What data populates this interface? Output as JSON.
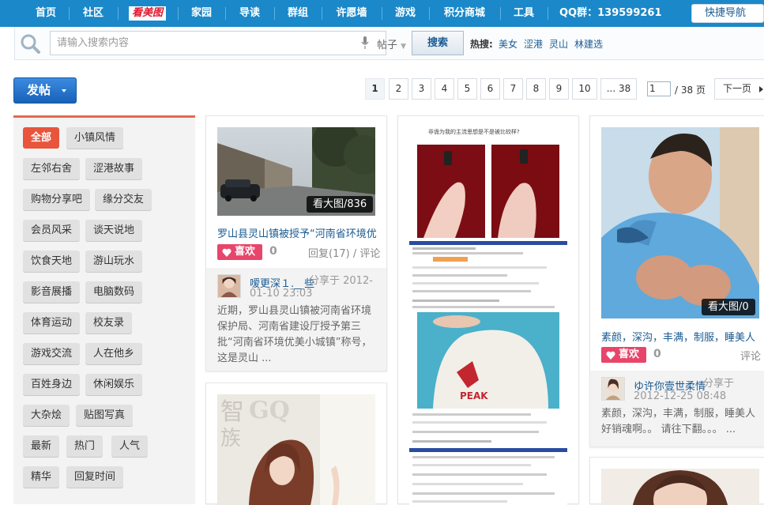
{
  "nav": {
    "items": [
      "首页",
      "社区",
      "看美图",
      "家园",
      "导读",
      "群组",
      "许愿墙",
      "游戏",
      "积分商城",
      "工具"
    ],
    "qq": "QQ群：139599261",
    "quick_nav": "快捷导航"
  },
  "search": {
    "placeholder": "请输入搜索内容",
    "type": "帖子",
    "button": "搜索",
    "hot_label": "热搜:",
    "hot_keywords": [
      "美女",
      "涩港",
      "灵山",
      "林建选"
    ]
  },
  "post_button": "发帖",
  "pager": {
    "pages": [
      "1",
      "2",
      "3",
      "4",
      "5",
      "6",
      "7",
      "8",
      "9",
      "10",
      "... 38"
    ],
    "current": "1",
    "input_value": "1",
    "total": "/ 38 页",
    "next": "下一页"
  },
  "sidebar": {
    "tags": [
      "全部",
      "小镇风情",
      "左邻右舍",
      "涩港故事",
      "购物分享吧",
      "缘分交友",
      "会员风采",
      "谈天说地",
      "饮食天地",
      "游山玩水",
      "影音展播",
      "电脑数码",
      "体育运动",
      "校友录",
      "游戏交流",
      "人在他乡",
      "百姓身边",
      "休闲娱乐",
      "大杂烩",
      "贴图写真",
      "最新",
      "热门",
      "人气",
      "精华",
      "回复时间"
    ]
  },
  "cards": [
    {
      "big_label": "看大图/836",
      "title": "罗山县灵山镇被授予“河南省环境优美",
      "like": "喜欢",
      "like_count": "0",
      "reply": "回复(17) / 评论",
      "user": "嗳更深１.__些",
      "share": "分享于 2012-01-10 23:03",
      "desc": "近期，罗山县灵山镇被河南省环境保护局、河南省建设厅授予第三批“河南省环境优美小城镇”称号，这是灵山 ..."
    },
    {
      "big_label": "看大图/0",
      "title": "素颜，深沟，丰满，制服，睡美人",
      "like": "喜欢",
      "like_count": "0",
      "reply": "评论",
      "user": "ゆ许你壹世柔情",
      "share": "分享于 2012-12-25 08:48",
      "desc": "素颜，深沟，丰满，制服，睡美人 好销魂啊。。 请往下翻。。。 ..."
    }
  ],
  "card_middle": {
    "caption": "非诡为我的主流思想是不是被比较样?"
  },
  "colors": {
    "nav_bg": "#1a88c9",
    "accent_red": "#e8553c",
    "like_pink": "#e8456a",
    "link_blue": "#1a5b93"
  }
}
